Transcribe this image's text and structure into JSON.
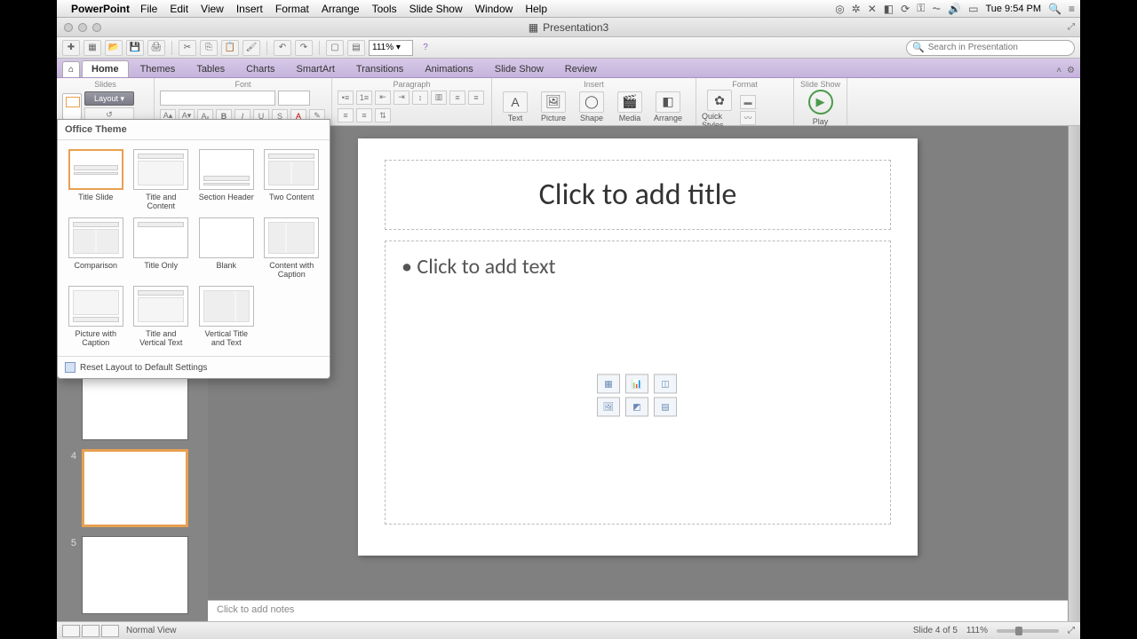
{
  "mac_menu": {
    "app": "PowerPoint",
    "items": [
      "File",
      "Edit",
      "View",
      "Insert",
      "Format",
      "Arrange",
      "Tools",
      "Slide Show",
      "Window",
      "Help"
    ],
    "clock": "Tue 9:54 PM"
  },
  "window": {
    "title": "Presentation3"
  },
  "toolbar": {
    "zoom": "111% ▾",
    "search_placeholder": "Search in Presentation"
  },
  "ribbon_tabs": [
    "Home",
    "Themes",
    "Tables",
    "Charts",
    "SmartArt",
    "Transitions",
    "Animations",
    "Slide Show",
    "Review"
  ],
  "ribbon": {
    "groups": {
      "slides": "Slides",
      "font": "Font",
      "paragraph": "Paragraph",
      "insert": "Insert",
      "format": "Format",
      "slideshow": "Slide Show"
    },
    "layout_btn": "Layout ▾",
    "insert_btns": {
      "text": "Text",
      "picture": "Picture",
      "shape": "Shape",
      "media": "Media",
      "arrange": "Arrange",
      "quick": "Quick Styles"
    },
    "play": "Play"
  },
  "layout_popup": {
    "header": "Office Theme",
    "items": [
      "Title Slide",
      "Title and Content",
      "Section Header",
      "Two Content",
      "Comparison",
      "Title Only",
      "Blank",
      "Content with Caption",
      "Picture with Caption",
      "Title and Vertical Text",
      "Vertical Title and Text"
    ],
    "reset": "Reset Layout to Default Settings"
  },
  "slide": {
    "title_placeholder": "Click to add title",
    "text_placeholder": "Click to add text"
  },
  "thumbs": {
    "selected": 4,
    "count": 5
  },
  "notes": {
    "placeholder": "Click to add notes"
  },
  "status": {
    "view": "Normal View",
    "slide": "Slide 4 of 5",
    "zoom": "111%"
  }
}
